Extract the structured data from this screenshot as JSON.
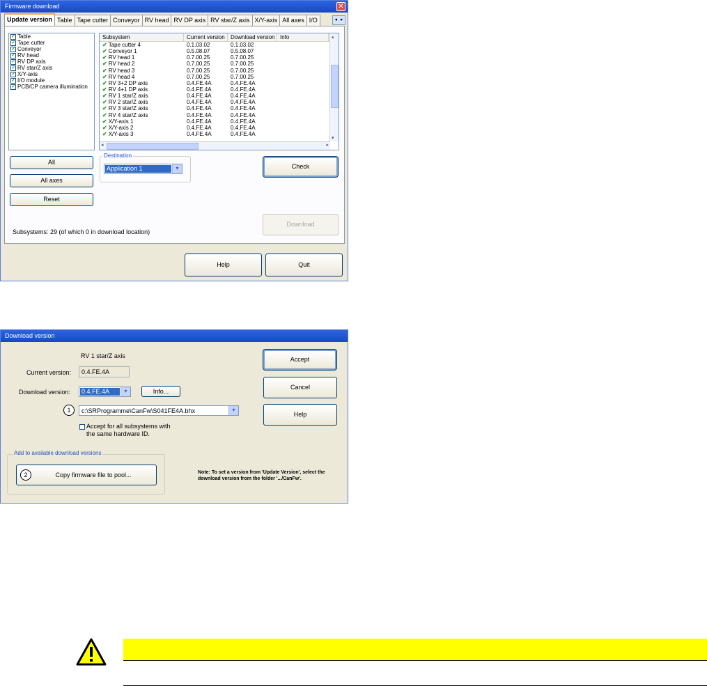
{
  "firmware_window": {
    "title": "Firmware download",
    "close_label": "✕",
    "tabs": [
      "Update version",
      "Table",
      "Tape cutter",
      "Conveyor",
      "RV head",
      "RV DP axis",
      "RV star/Z axis",
      "X/Y-axis",
      "All axes",
      "I/O"
    ],
    "checklist": [
      "Table",
      "Tape cutter",
      "Conveyor",
      "RV head",
      "RV DP axis",
      "RV star/Z axis",
      "X/Y-axis",
      "I/O module",
      "PCB/CP camera illumination"
    ],
    "grid": {
      "columns": [
        "Subsystem",
        "Current version",
        "Download version",
        "Info"
      ],
      "rows": [
        {
          "name": "Tape cutter 4",
          "current": "0.1.03.02",
          "download": "0.1.03.02"
        },
        {
          "name": "Conveyor 1",
          "current": "0.5.08.07",
          "download": "0.5.08.07"
        },
        {
          "name": "RV head 1",
          "current": "0.7.00.25",
          "download": "0.7.00.25"
        },
        {
          "name": "RV head 2",
          "current": "0.7.00.25",
          "download": "0.7.00.25"
        },
        {
          "name": "RV head 3",
          "current": "0.7.00.25",
          "download": "0.7.00.25"
        },
        {
          "name": "RV head 4",
          "current": "0.7.00.25",
          "download": "0.7.00.25"
        },
        {
          "name": "RV 3+2 DP axis",
          "current": "0.4.FE.4A",
          "download": "0.4.FE.4A"
        },
        {
          "name": "RV 4+1 DP axis",
          "current": "0.4.FE.4A",
          "download": "0.4.FE.4A"
        },
        {
          "name": "RV 1 star/Z axis",
          "current": "0.4.FE.4A",
          "download": "0.4.FE.4A"
        },
        {
          "name": "RV 2 star/Z axis",
          "current": "0.4.FE.4A",
          "download": "0.4.FE.4A"
        },
        {
          "name": "RV 3 star/Z axis",
          "current": "0.4.FE.4A",
          "download": "0.4.FE.4A"
        },
        {
          "name": "RV 4 star/Z axis",
          "current": "0.4.FE.4A",
          "download": "0.4.FE.4A"
        },
        {
          "name": "X/Y-axis 1",
          "current": "0.4.FE.4A",
          "download": "0.4.FE.4A"
        },
        {
          "name": "X/Y-axis 2",
          "current": "0.4.FE.4A",
          "download": "0.4.FE.4A"
        },
        {
          "name": "X/Y-axis 3",
          "current": "0.4.FE.4A",
          "download": "0.4.FE.4A"
        }
      ]
    },
    "buttons": {
      "all": "All",
      "all_axes": "All axes",
      "reset": "Reset",
      "check": "Check",
      "download": "Download",
      "help": "Help",
      "quit": "Quit"
    },
    "destination": {
      "label": "Destination",
      "value": "Application 1"
    },
    "subsystems_text": "Subsystems: 29 (of which 0 in download location)"
  },
  "download_window": {
    "title": "Download version",
    "subsystem_name": "RV 1 star/Z axis",
    "current_version_label": "Current version:",
    "current_version_value": "0.4.FE.4A",
    "download_version_label": "Download version:",
    "download_version_value": "0.4.FE.4A",
    "info_button": "Info...",
    "marker_1": "1",
    "marker_2": "2",
    "file_path": "c:\\SRProgramme\\CanFw\\S041FE4A.bhx",
    "accept_all_line1": "Accept for all subsystems with",
    "accept_all_line2": "the same hardware ID.",
    "add_group_label": "Add to available download versions",
    "copy_button": "Copy firmware file to pool...",
    "accept_button": "Accept",
    "cancel_button": "Cancel",
    "help_button": "Help",
    "note_line1": "Note: To set a version from 'Update Version', select the",
    "note_line2": "download version from the folder '.../CanFw'."
  },
  "colors": {
    "warning_bar": "#ffff00",
    "title_bar": "#2c64e0",
    "selection": "#316ac5"
  }
}
